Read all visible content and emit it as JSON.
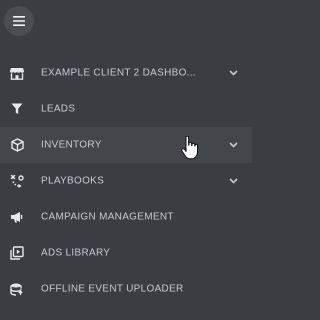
{
  "menu_toggle": {
    "icon": "hamburger-icon"
  },
  "nav": {
    "items": [
      {
        "label": "EXAMPLE CLIENT 2 DASHBO...",
        "icon": "storefront-icon",
        "has_children": true
      },
      {
        "label": "LEADS",
        "icon": "filter-icon",
        "has_children": false
      },
      {
        "label": "INVENTORY",
        "icon": "box-icon",
        "has_children": true,
        "hovered": true
      },
      {
        "label": "PLAYBOOKS",
        "icon": "playbook-icon",
        "has_children": true
      },
      {
        "label": "CAMPAIGN MANAGEMENT",
        "icon": "megaphone-icon",
        "has_children": false
      },
      {
        "label": "ADS LIBRARY",
        "icon": "ads-library-icon",
        "has_children": false
      },
      {
        "label": "OFFLINE EVENT UPLOADER",
        "icon": "database-upload-icon",
        "has_children": false
      }
    ]
  },
  "colors": {
    "background": "#3a3e43",
    "hover_background": "#43474c",
    "text": "#c7cacf",
    "icon": "#e6e8eb"
  }
}
